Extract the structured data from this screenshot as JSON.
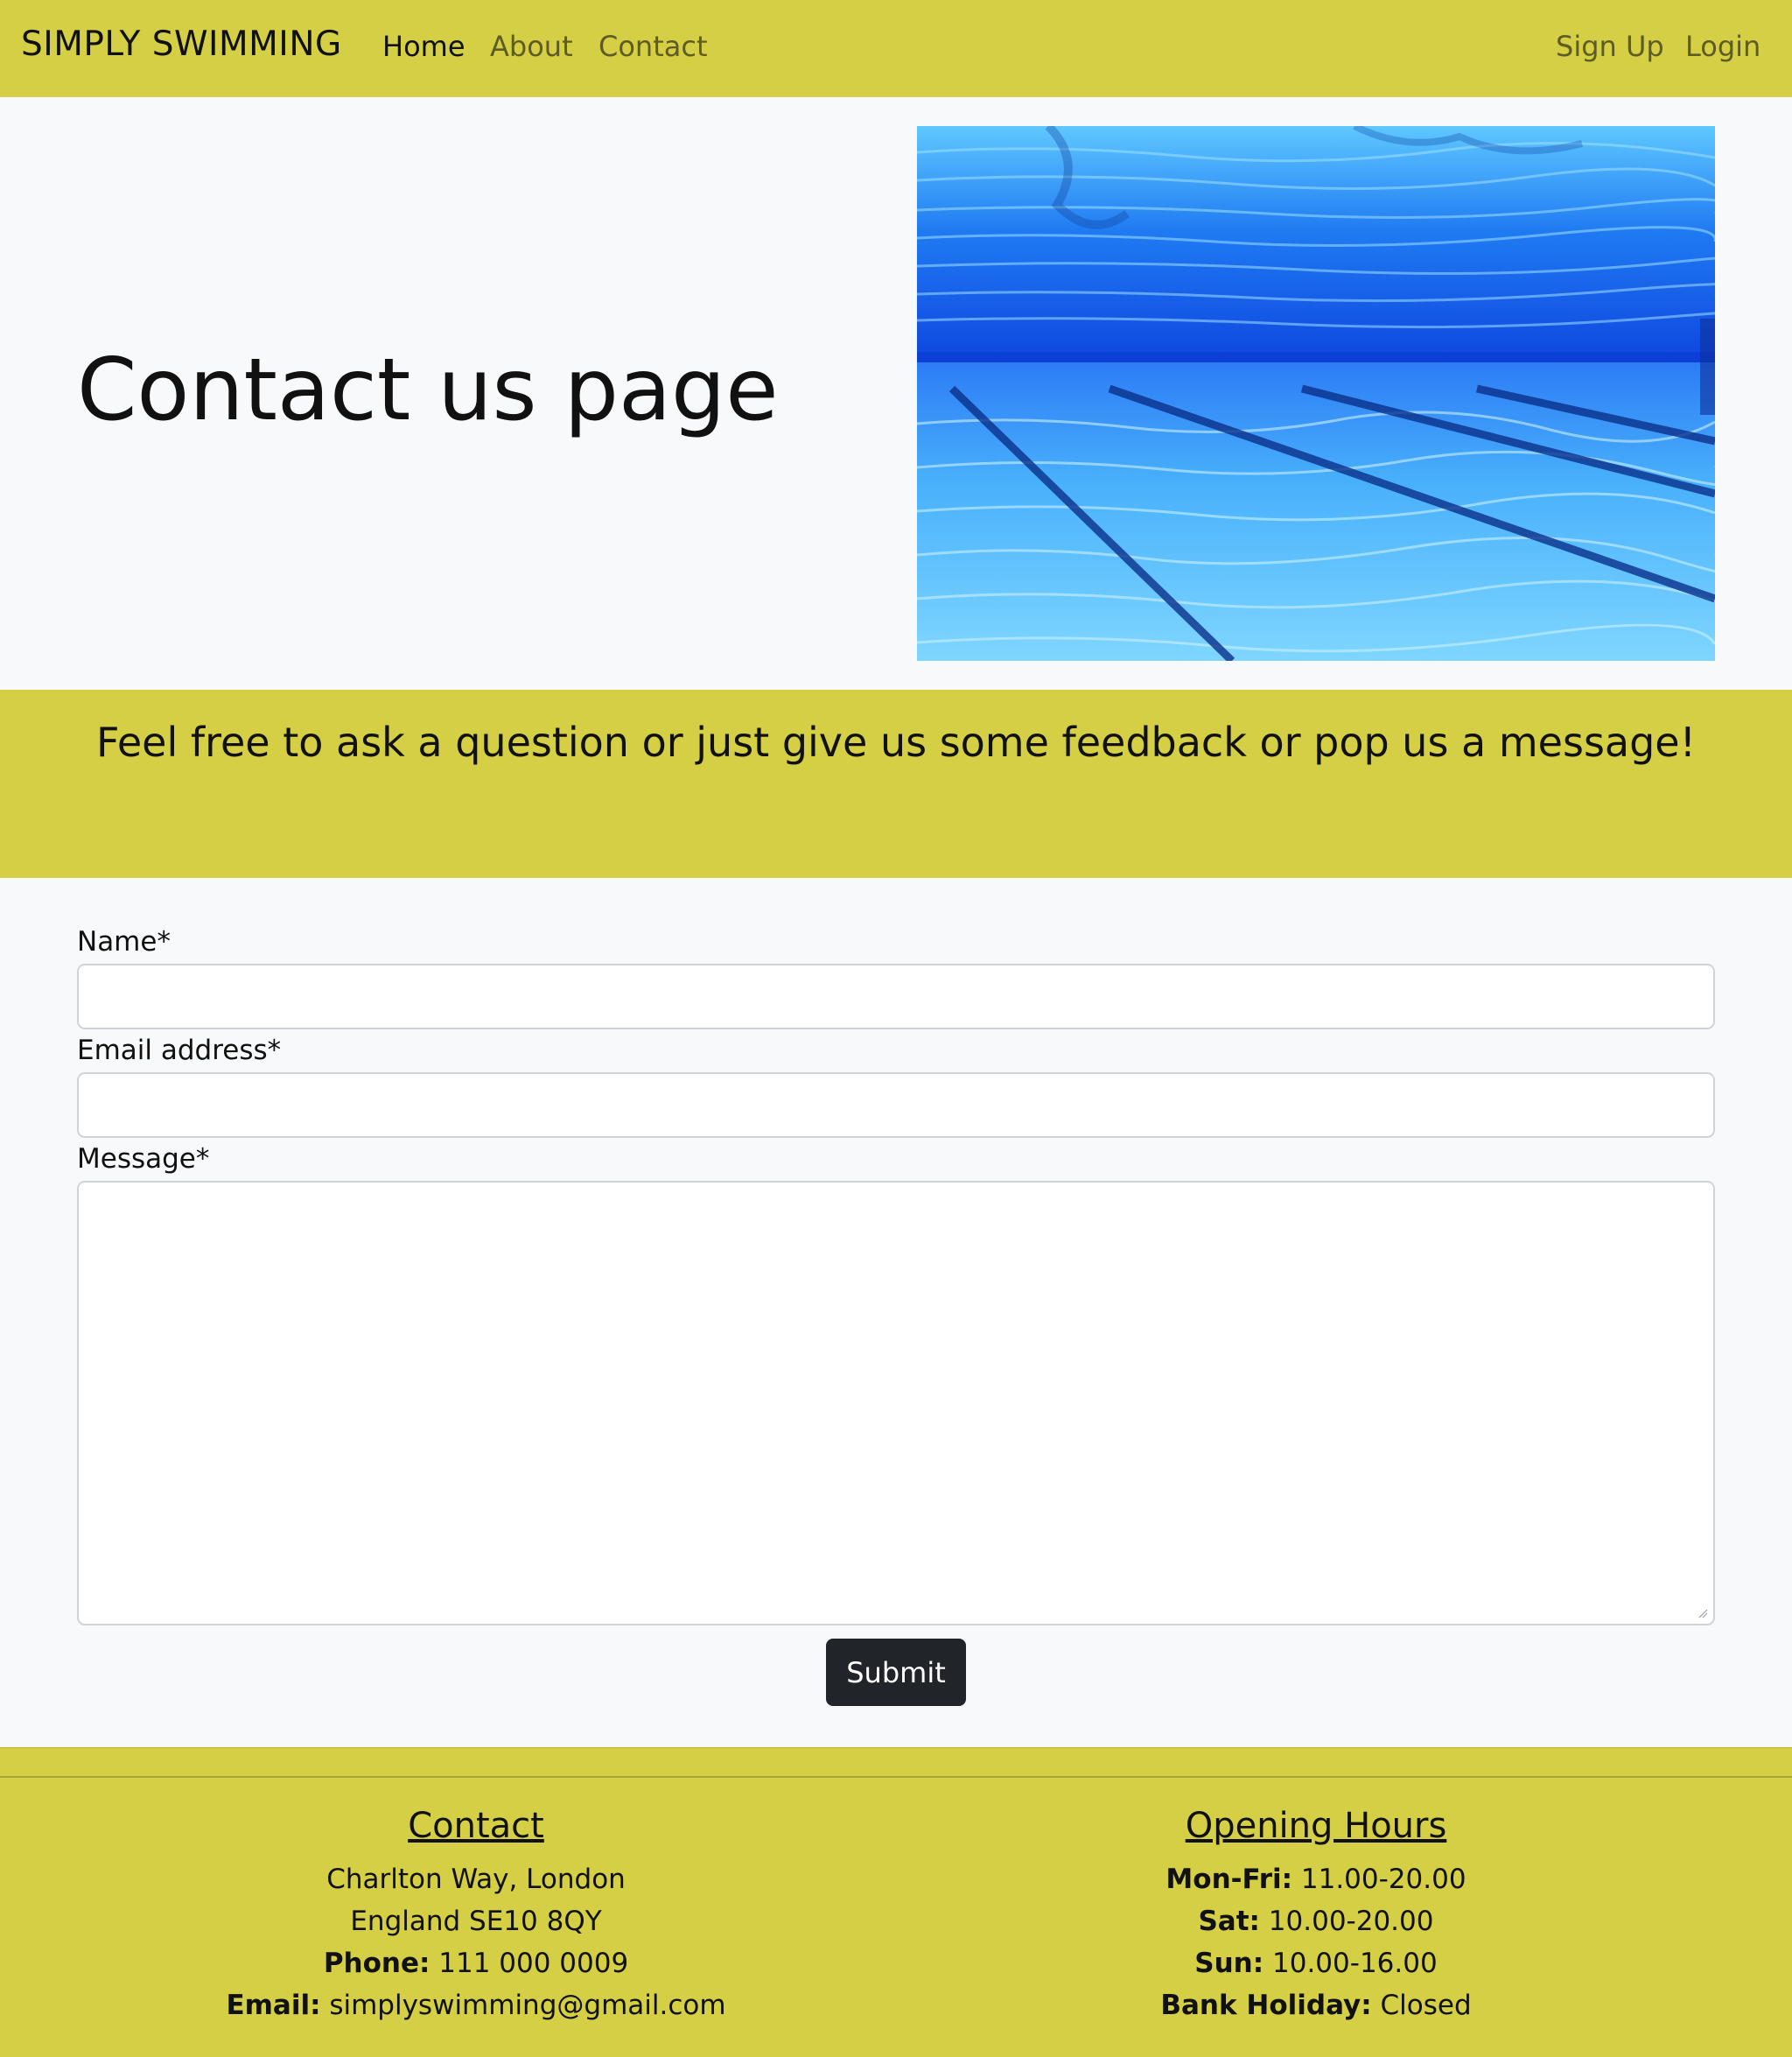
{
  "nav": {
    "brand": "SIMPLY SWIMMING",
    "links": [
      "Home",
      "About",
      "Contact"
    ],
    "auth": [
      "Sign Up",
      "Login"
    ]
  },
  "hero": {
    "title": "Contact us page",
    "image_alt": "underwater swimming pool lanes"
  },
  "banner": {
    "text": "Feel free to ask a question or just give us some feedback or pop us a message!"
  },
  "form": {
    "name_label": "Name*",
    "name_value": "",
    "email_label": "Email address*",
    "email_value": "",
    "message_label": "Message*",
    "message_value": "",
    "submit_label": "Submit"
  },
  "footer": {
    "contact": {
      "heading": "Contact",
      "address_line1": "Charlton Way, London",
      "address_line2": "England SE10 8QY",
      "phone_label": "Phone:",
      "phone_value": " 111 000 0009",
      "email_label": "Email:",
      "email_value": " simplyswimming@gmail.com"
    },
    "hours": {
      "heading": "Opening Hours",
      "rows": [
        {
          "label": "Mon-Fri:",
          "value": " 11.00-20.00"
        },
        {
          "label": "Sat:",
          "value": " 10.00-20.00"
        },
        {
          "label": "Sun:",
          "value": " 10.00-16.00"
        },
        {
          "label": "Bank Holiday:",
          "value": " Closed"
        }
      ]
    }
  },
  "colors": {
    "accent": "#d4cf44",
    "background": "#f8f9fa",
    "button": "#212529"
  }
}
